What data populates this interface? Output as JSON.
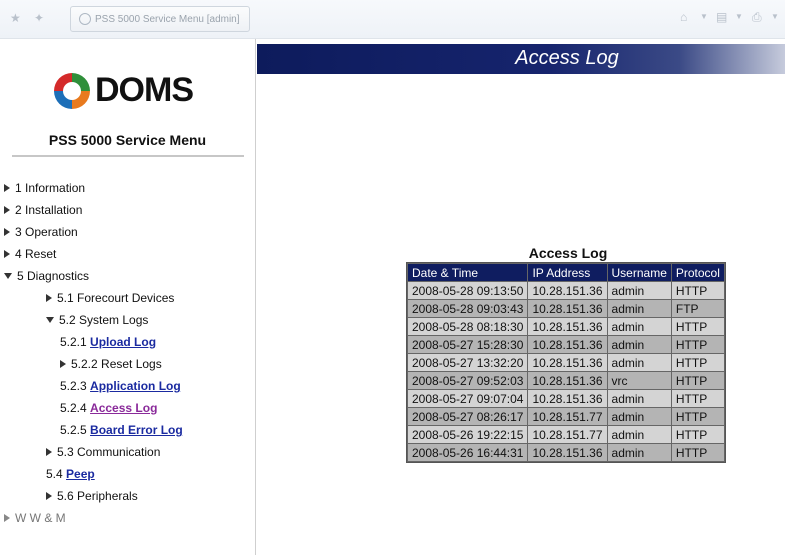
{
  "browser": {
    "tab_title": "PSS 5000 Service Menu [admin]"
  },
  "sidebar": {
    "logo_text": "DOMS",
    "menu_title": "PSS 5000 Service Menu",
    "items": [
      {
        "label": "1 Information"
      },
      {
        "label": "2 Installation"
      },
      {
        "label": "3 Operation"
      },
      {
        "label": "4 Reset"
      },
      {
        "label": "5 Diagnostics"
      },
      {
        "label": "5.1 Forecourt Devices"
      },
      {
        "label": "5.2 System Logs"
      },
      {
        "prefix": "5.2.1",
        "link": "Upload Log"
      },
      {
        "label": "5.2.2 Reset Logs"
      },
      {
        "prefix": "5.2.3",
        "link": "Application Log"
      },
      {
        "prefix": "5.2.4",
        "link": "Access Log"
      },
      {
        "prefix": "5.2.5",
        "link": "Board Error Log"
      },
      {
        "label": "5.3 Communication"
      },
      {
        "prefix": "5.4",
        "link": "Peep"
      },
      {
        "label": "5.6 Peripherals"
      },
      {
        "label": "W W & M"
      }
    ]
  },
  "main": {
    "header_title": "Access Log",
    "table_title": "Access Log",
    "columns": [
      "Date & Time",
      "IP Address",
      "Username",
      "Protocol"
    ],
    "rows": [
      [
        "2008-05-28 09:13:50",
        "10.28.151.36",
        "admin",
        "HTTP"
      ],
      [
        "2008-05-28 09:03:43",
        "10.28.151.36",
        "admin",
        "FTP"
      ],
      [
        "2008-05-28 08:18:30",
        "10.28.151.36",
        "admin",
        "HTTP"
      ],
      [
        "2008-05-27 15:28:30",
        "10.28.151.36",
        "admin",
        "HTTP"
      ],
      [
        "2008-05-27 13:32:20",
        "10.28.151.36",
        "admin",
        "HTTP"
      ],
      [
        "2008-05-27 09:52:03",
        "10.28.151.36",
        "vrc",
        "HTTP"
      ],
      [
        "2008-05-27 09:07:04",
        "10.28.151.36",
        "admin",
        "HTTP"
      ],
      [
        "2008-05-27 08:26:17",
        "10.28.151.77",
        "admin",
        "HTTP"
      ],
      [
        "2008-05-26 19:22:15",
        "10.28.151.77",
        "admin",
        "HTTP"
      ],
      [
        "2008-05-26 16:44:31",
        "10.28.151.36",
        "admin",
        "HTTP"
      ]
    ]
  }
}
